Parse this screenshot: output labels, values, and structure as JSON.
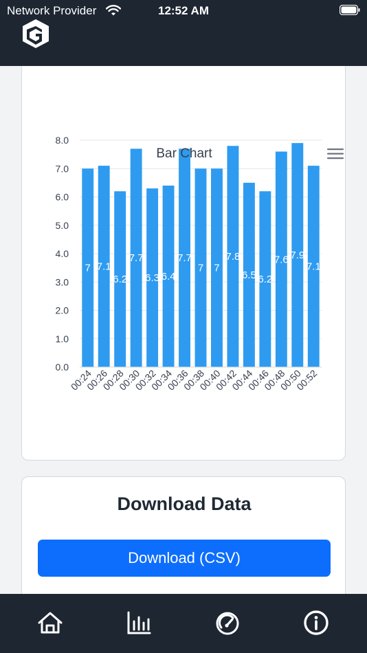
{
  "status": {
    "carrier": "Network Provider",
    "time": "12:52 AM"
  },
  "chart_data": {
    "type": "bar",
    "title": "Bar Chart",
    "categories": [
      "00:24",
      "00:26",
      "00:28",
      "00:30",
      "00:32",
      "00:34",
      "00:36",
      "00:38",
      "00:40",
      "00:42",
      "00:44",
      "00:46",
      "00:48",
      "00:50",
      "00:52"
    ],
    "values": [
      7.0,
      7.1,
      6.2,
      7.7,
      6.3,
      6.4,
      7.7,
      7.0,
      7.0,
      7.8,
      6.5,
      6.2,
      7.6,
      7.9,
      7.1
    ],
    "data_labels": [
      "7",
      "7.1",
      "6.2",
      "7.7",
      "6.3",
      "6.4",
      "7.7",
      "7",
      "7",
      "7.8",
      "6.5",
      "6.2",
      "7.6",
      "7.9",
      "7.1"
    ],
    "y_ticks": [
      "0.0",
      "1.0",
      "2.0",
      "3.0",
      "4.0",
      "5.0",
      "6.0",
      "7.0",
      "8.0"
    ],
    "ylim": [
      0,
      8
    ],
    "grid": true,
    "bar_color": "#2e9bf0"
  },
  "download": {
    "title": "Download Data",
    "button_label": "Download (CSV)"
  },
  "nav": {
    "items": [
      "home-icon",
      "bar-chart-icon",
      "gauge-icon",
      "info-icon"
    ]
  },
  "colors": {
    "header_bg": "#1e2632",
    "primary": "#0d6efd"
  }
}
